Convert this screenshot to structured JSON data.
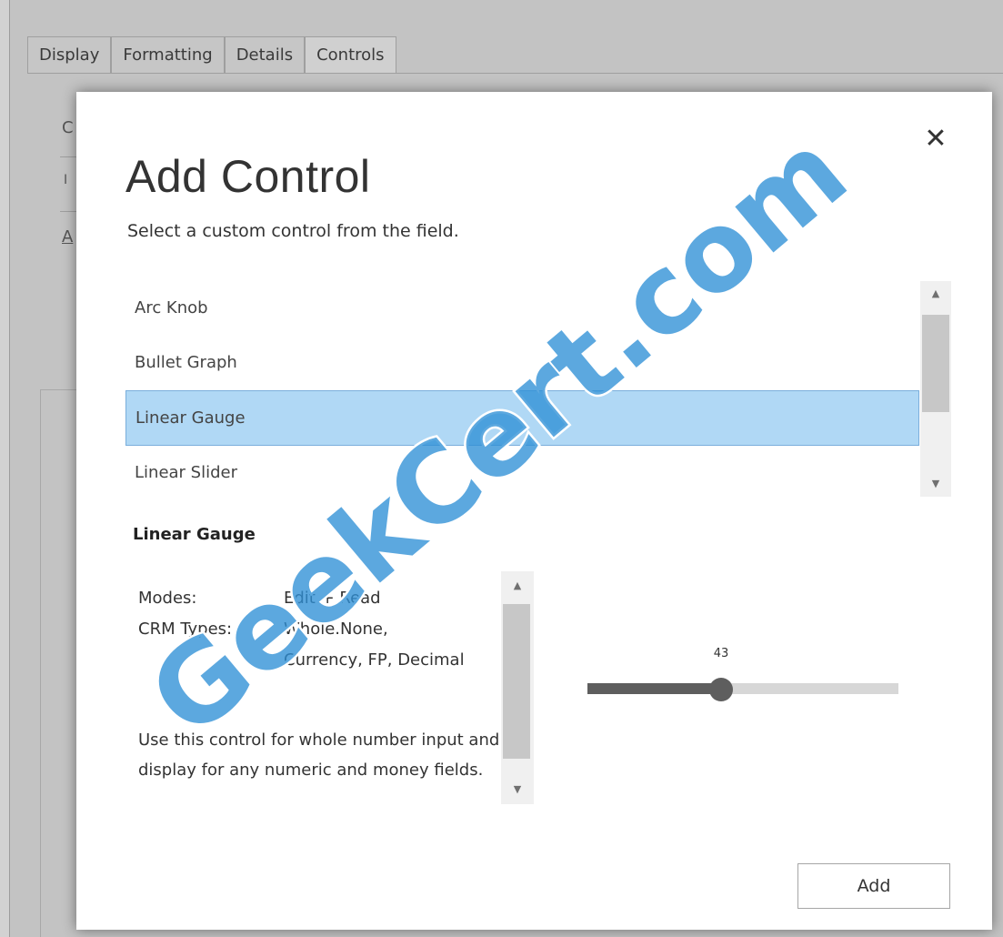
{
  "tabs": [
    "Display",
    "Formatting",
    "Details",
    "Controls"
  ],
  "background_fragments": [
    "C",
    "I",
    "A"
  ],
  "dialog": {
    "close_glyph": "✕",
    "title": "Add Control",
    "subtitle": "Select a custom control from the field.",
    "controls": [
      "Arc Knob",
      "Bullet Graph",
      "Linear Gauge",
      "Linear Slider"
    ],
    "selected_control": "Linear Gauge",
    "scroll_up_glyph": "▲",
    "scroll_down_glyph": "▼",
    "detail": {
      "heading": "Linear Gauge",
      "modes_label": "Modes:",
      "modes_value": "Edit + Read",
      "crm_types_label": "CRM Types:",
      "crm_types_line1": "Whole.None,",
      "crm_types_line2": "Currency, FP, Decimal",
      "description": "Use this control for whole number input and display for any numeric and money fields."
    },
    "preview": {
      "value": "43",
      "fill_fraction": 0.43
    },
    "add_button": "Add"
  },
  "watermark": "GeekCert.com",
  "colors": {
    "selection_bg": "#b0d8f5",
    "selection_border": "#7aaedc",
    "watermark": "#2e8fd6",
    "slider_fill": "#5e5e5e"
  }
}
